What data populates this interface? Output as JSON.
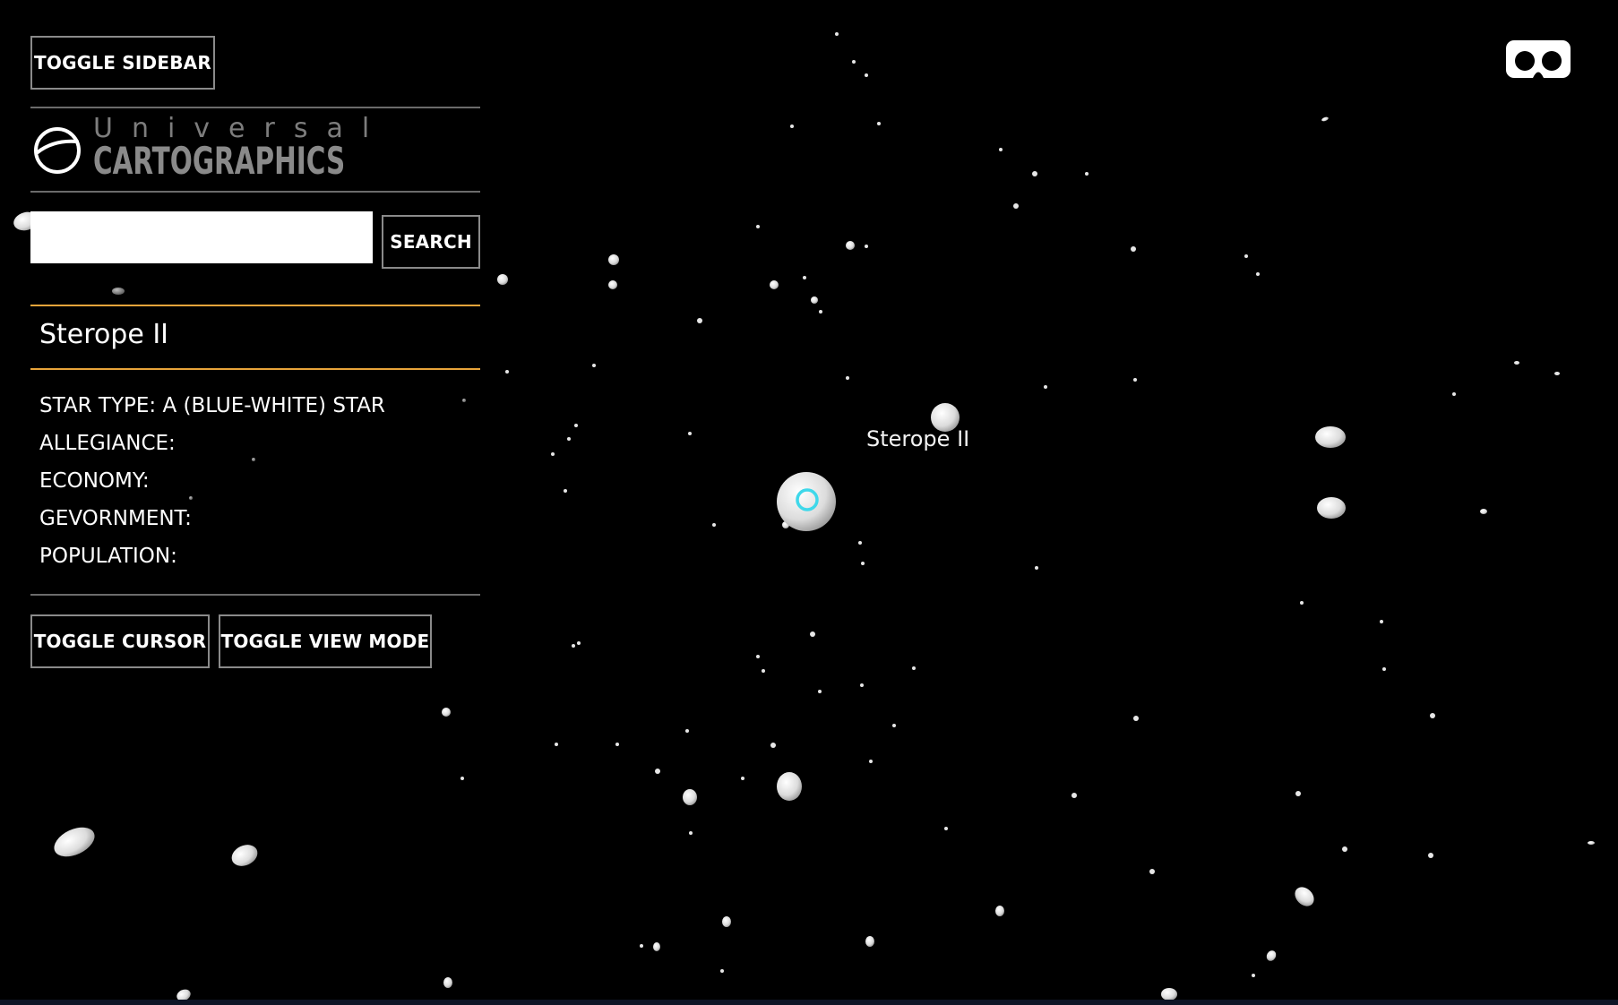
{
  "toolbar": {
    "toggle_sidebar_label": "TOGGLE SIDEBAR"
  },
  "logo": {
    "line1": "Universal",
    "line2": "CARTOGRAPHICS",
    "icon": "globe-logo-icon"
  },
  "search": {
    "value": "",
    "placeholder": "",
    "button_label": "SEARCH"
  },
  "selected_system": {
    "name": "Sterope II",
    "star_type": "STAR TYPE: A (BLUE-WHITE) STAR",
    "allegiance": "ALLEGIANCE:",
    "economy": "ECONOMY:",
    "government": "GEVORNMENT:",
    "population": "POPULATION:"
  },
  "controls": {
    "toggle_cursor_label": "TOGGLE CURSOR",
    "toggle_view_mode_label": "TOGGLE VIEW MODE"
  },
  "map": {
    "star_label": "Sterope II",
    "vr_icon": "vr-headset-icon",
    "cursor_icon": "target-ring-icon"
  },
  "colors": {
    "background": "#000000",
    "accent_rule": "#e8a43a",
    "border_gray": "#8a8a8a",
    "cursor_ring": "#3fd8ea"
  }
}
